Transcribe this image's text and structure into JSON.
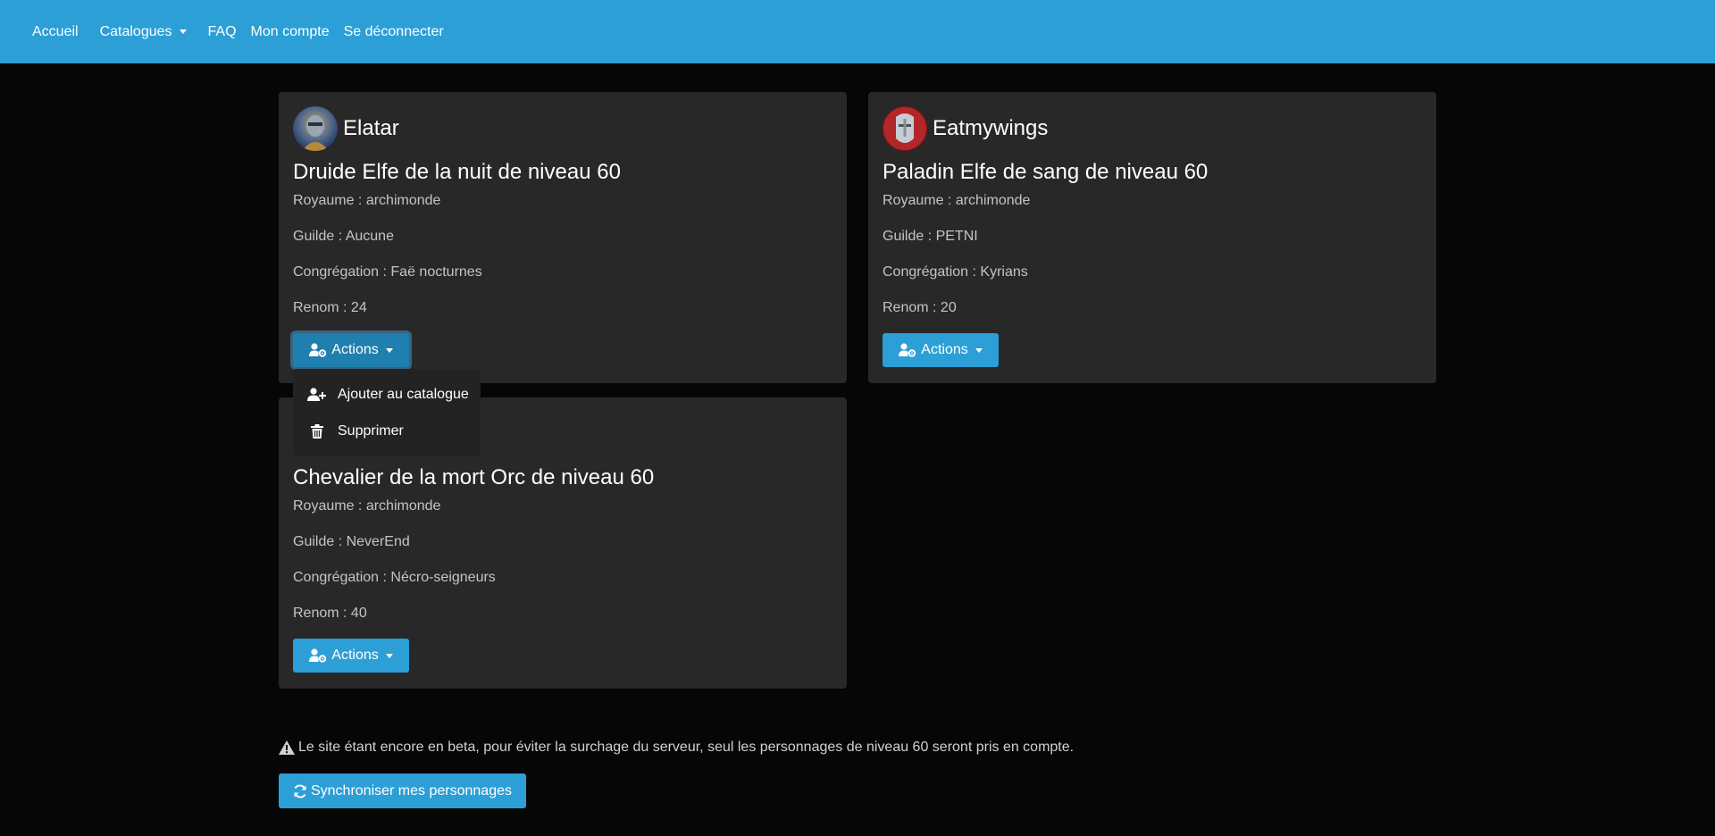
{
  "nav": {
    "home": "Accueil",
    "catalogues": "Catalogues",
    "faq": "FAQ",
    "account": "Mon compte",
    "logout": "Se déconnecter"
  },
  "characters": [
    {
      "name": "Elatar",
      "title": "Druide Elfe de la nuit de niveau 60",
      "realm": "Royaume : archimonde",
      "guild": "Guilde : Aucune",
      "covenant": "Congrégation : Faë nocturnes",
      "renown": "Renom : 24",
      "actions_label": "Actions",
      "avatar_icon": "druid-avatar"
    },
    {
      "name": "Eatmywings",
      "title": "Paladin Elfe de sang de niveau 60",
      "realm": "Royaume : archimonde",
      "guild": "Guilde : PETNI",
      "covenant": "Congrégation : Kyrians",
      "renown": "Renom : 20",
      "actions_label": "Actions",
      "avatar_icon": "paladin-avatar"
    },
    {
      "name": "",
      "title": "Chevalier de la mort Orc de niveau 60",
      "realm": "Royaume : archimonde",
      "guild": "Guilde : NeverEnd",
      "covenant": "Congrégation : Nécro-seigneurs",
      "renown": "Renom : 40",
      "actions_label": "Actions",
      "avatar_icon": "deathknight-avatar"
    }
  ],
  "dropdown": {
    "add_to_catalogue": "Ajouter au catalogue",
    "delete": "Supprimer"
  },
  "footer": {
    "beta_note": "Le site étant encore en beta, pour éviter la surchage du serveur, seul les personnages de niveau 60 seront pris en compte.",
    "sync_button": "Synchroniser mes personnages"
  },
  "colors": {
    "primary": "#2c9fd7",
    "background": "#060606",
    "card": "#282828"
  }
}
